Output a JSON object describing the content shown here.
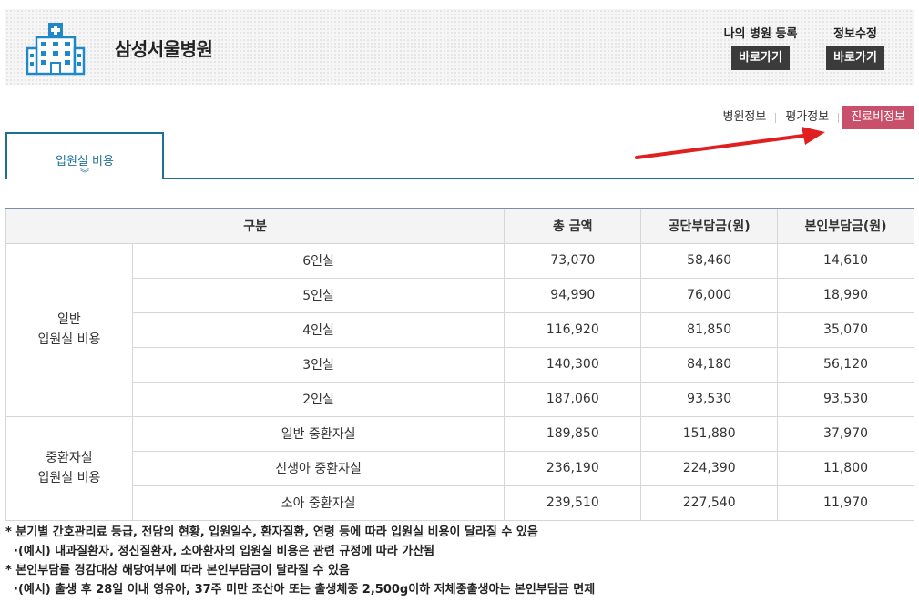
{
  "header": {
    "hospital_name": "삼성서울병원",
    "icon": "hospital-building-icon",
    "my_hospital_label": "나의 병원 등록",
    "my_hospital_button": "바로가기",
    "edit_info_label": "정보수정",
    "edit_info_button": "바로가기"
  },
  "subnav": {
    "items": [
      "병원정보",
      "평가정보",
      "진료비정보"
    ],
    "active": "진료비정보",
    "active_color": "#c9506a"
  },
  "tab": {
    "label": "입원실 비용",
    "icon": "double-chevron-down-icon",
    "color": "#1e6f93"
  },
  "table": {
    "headers": [
      "구분",
      "총 금액",
      "공단부담금(원)",
      "본인부담금(원)"
    ],
    "groups": [
      {
        "label_line1": "일반",
        "label_line2": "입원실 비용",
        "rows": [
          {
            "type": "6인실",
            "total": "73,070",
            "public": "58,460",
            "self": "14,610"
          },
          {
            "type": "5인실",
            "total": "94,990",
            "public": "76,000",
            "self": "18,990"
          },
          {
            "type": "4인실",
            "total": "116,920",
            "public": "81,850",
            "self": "35,070"
          },
          {
            "type": "3인실",
            "total": "140,300",
            "public": "84,180",
            "self": "56,120"
          },
          {
            "type": "2인실",
            "total": "187,060",
            "public": "93,530",
            "self": "93,530"
          }
        ]
      },
      {
        "label_line1": "중환자실",
        "label_line2": "입원실 비용",
        "rows": [
          {
            "type": "일반 중환자실",
            "total": "189,850",
            "public": "151,880",
            "self": "37,970"
          },
          {
            "type": "신생아 중환자실",
            "total": "236,190",
            "public": "224,390",
            "self": "11,800"
          },
          {
            "type": "소아 중환자실",
            "total": "239,510",
            "public": "227,540",
            "self": "11,970"
          }
        ]
      }
    ]
  },
  "notes": [
    "* 분기별 간호관리료 등급, 전담의 현황, 입원일수, 환자질환, 연령 등에 따라 입원실 비용이 달라질 수 있음",
    "·(예시) 내과질환자, 정신질환자, 소아환자의 입원실 비용은 관련 규정에 따라 가산됨",
    "* 본인부담률 경감대상 해당여부에 따라 본인부담금이 달라질 수 있음",
    "·(예시) 출생 후 28일 이내 영유아, 37주 미만 조산아 또는 출생체중 2,500g이하 저체중출생아는 본인부담금 면제"
  ],
  "annotation": {
    "arrow_color": "#e02020"
  }
}
